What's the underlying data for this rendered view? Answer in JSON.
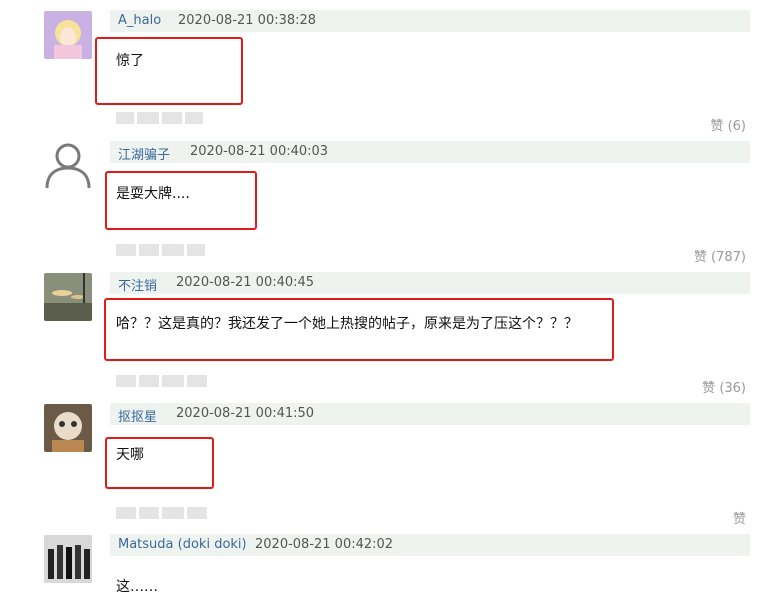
{
  "like_label": "赞",
  "comments": [
    {
      "username": "A_halo",
      "time": "2020-08-21 00:38:28",
      "text": "惊了",
      "likes": "(6)",
      "avatar": "anime-girl-avatar"
    },
    {
      "username": "江湖骗子",
      "time": "2020-08-21 00:40:03",
      "text": "是耍大牌....",
      "likes": "(787)",
      "avatar": "default-user-avatar"
    },
    {
      "username": "不注销",
      "time": "2020-08-21 00:40:45",
      "text": "哈？？这是真的？我还发了一个她上热搜的帖子，原来是为了压这个？？？",
      "likes": "(36)",
      "avatar": "scenery-avatar"
    },
    {
      "username": "抠抠星",
      "time": "2020-08-21 00:41:50",
      "text": "天哪",
      "likes": "",
      "avatar": "cartoon-avatar"
    },
    {
      "username": "Matsuda (doki doki)",
      "time": "2020-08-21 00:42:02",
      "text": "这……",
      "likes": "",
      "avatar": "group-photo-avatar"
    }
  ],
  "colors": {
    "highlight": "#e11a1a",
    "header_bg": "#eef3ef",
    "username": "#3a6a9b"
  }
}
